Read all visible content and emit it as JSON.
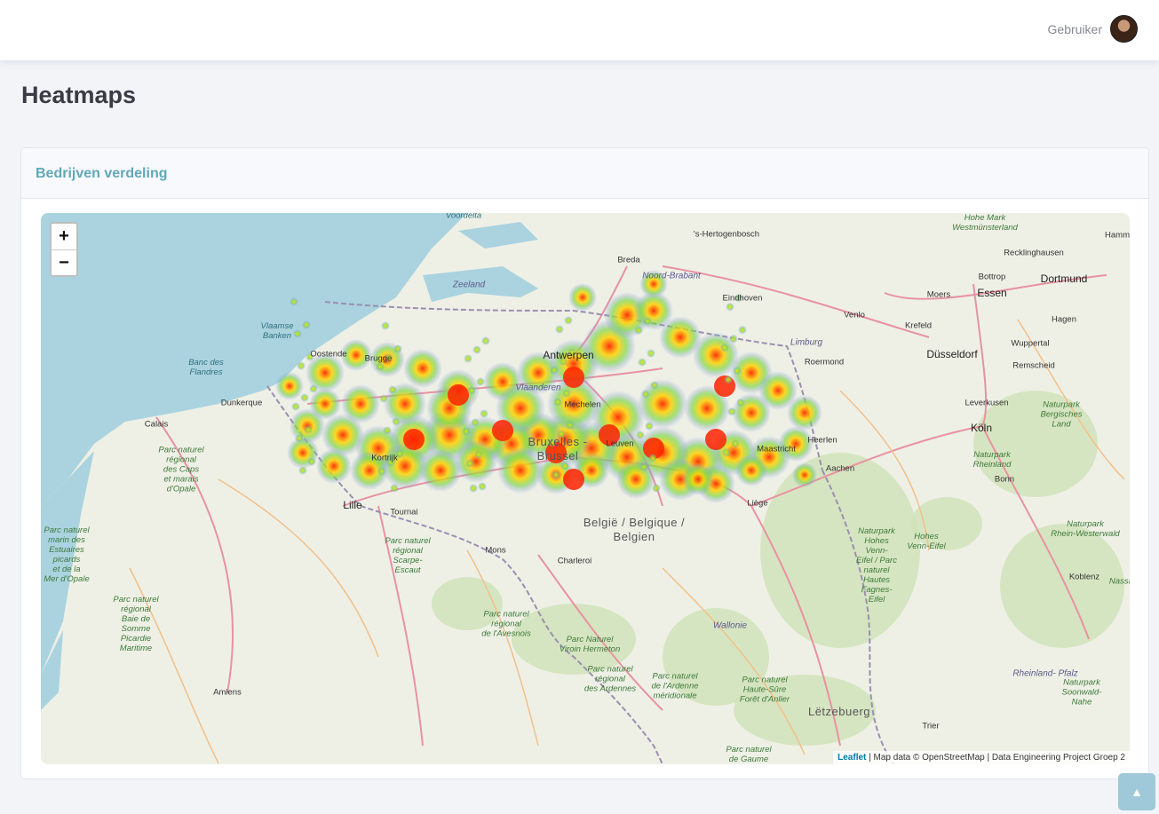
{
  "topbar": {
    "user_name": "Gebruiker"
  },
  "page": {
    "title": "Heatmaps"
  },
  "card": {
    "title": "Bedrijven verdeling"
  },
  "map": {
    "zoom_in": "+",
    "zoom_out": "−",
    "attribution_link": "Leaflet",
    "attribution_text": " | Map data © OpenStreetMap | Data Engineering Project Groep 2",
    "colors": {
      "sea": "#aad3df",
      "land": "#eef0e6",
      "heat_low": "#8888ff",
      "heat_mid": "#7fd84a",
      "heat_high": "#ff2a00"
    },
    "labels": [
      {
        "id": "voordelta",
        "text": "Voordelta",
        "kind": "sea"
      },
      {
        "id": "hertogenbosch",
        "text": "'s-Hertogenbosch",
        "kind": "city"
      },
      {
        "id": "hohe-mark",
        "text": "Hohe Mark\nWestmünsterland",
        "kind": "green"
      },
      {
        "id": "hamm",
        "text": "Hamm",
        "kind": "city"
      },
      {
        "id": "breda",
        "text": "Breda",
        "kind": "city"
      },
      {
        "id": "noord-brabant",
        "text": "Noord-Brabant",
        "kind": "region"
      },
      {
        "id": "recklinghausen",
        "text": "Recklinghausen",
        "kind": "city"
      },
      {
        "id": "zeeland",
        "text": "Zeeland",
        "kind": "region"
      },
      {
        "id": "bottrop",
        "text": "Bottrop",
        "kind": "city"
      },
      {
        "id": "essen",
        "text": "Essen",
        "kind": "big"
      },
      {
        "id": "dortmund",
        "text": "Dortmund",
        "kind": "big"
      },
      {
        "id": "eindhoven",
        "text": "Eindhoven",
        "kind": "city"
      },
      {
        "id": "moers",
        "text": "Moers",
        "kind": "city"
      },
      {
        "id": "venlo",
        "text": "Venlo",
        "kind": "city"
      },
      {
        "id": "krefeld",
        "text": "Krefeld",
        "kind": "city"
      },
      {
        "id": "hagen",
        "text": "Hagen",
        "kind": "city"
      },
      {
        "id": "vlaamse-banken",
        "text": "Vlaamse\nBanken",
        "kind": "sea"
      },
      {
        "id": "limburg",
        "text": "Limburg",
        "kind": "region"
      },
      {
        "id": "wuppertal",
        "text": "Wuppertal",
        "kind": "city"
      },
      {
        "id": "antwerpen",
        "text": "Antwerpen",
        "kind": "big"
      },
      {
        "id": "oostende",
        "text": "Oostende",
        "kind": "city"
      },
      {
        "id": "brugge",
        "text": "Brugge",
        "kind": "city"
      },
      {
        "id": "roermond",
        "text": "Roermond",
        "kind": "city"
      },
      {
        "id": "dusseldorf",
        "text": "Düsseldorf",
        "kind": "big"
      },
      {
        "id": "remscheid",
        "text": "Remscheid",
        "kind": "city"
      },
      {
        "id": "banc-des-flandres",
        "text": "Banc des\nFlandres",
        "kind": "sea"
      },
      {
        "id": "vlaanderen",
        "text": "Vlaanderen",
        "kind": "region"
      },
      {
        "id": "dunkerque",
        "text": "Dunkerque",
        "kind": "city"
      },
      {
        "id": "mechelen",
        "text": "Mechelen",
        "kind": "city"
      },
      {
        "id": "leverkusen",
        "text": "Leverkusen",
        "kind": "city"
      },
      {
        "id": "naturpark-bergisches",
        "text": "Naturpark\nBergisches\nLand",
        "kind": "green"
      },
      {
        "id": "calais",
        "text": "Calais",
        "kind": "city"
      },
      {
        "id": "koln",
        "text": "Köln",
        "kind": "big"
      },
      {
        "id": "heerlen",
        "text": "Heerlen",
        "kind": "city"
      },
      {
        "id": "brussel",
        "text": "Bruxelles -\nBrussel",
        "kind": "country"
      },
      {
        "id": "leuven",
        "text": "Leuven",
        "kind": "city"
      },
      {
        "id": "maastricht",
        "text": "Maastricht",
        "kind": "city"
      },
      {
        "id": "parc-caps",
        "text": "Parc naturel\nrégional\ndes Caps\net marais\nd'Opale",
        "kind": "green"
      },
      {
        "id": "kortrijk",
        "text": "Kortrijk",
        "kind": "city"
      },
      {
        "id": "naturpark-rheinland",
        "text": "Naturpark\nRheinland",
        "kind": "green"
      },
      {
        "id": "aachen",
        "text": "Aachen",
        "kind": "city"
      },
      {
        "id": "bonn",
        "text": "Bonn",
        "kind": "city"
      },
      {
        "id": "lille",
        "text": "Lille",
        "kind": "big"
      },
      {
        "id": "tournai",
        "text": "Tournai",
        "kind": "city"
      },
      {
        "id": "liege",
        "text": "Liège",
        "kind": "city"
      },
      {
        "id": "belgie",
        "text": "België / Belgique /\nBelgien",
        "kind": "country"
      },
      {
        "id": "parc-estuaires",
        "text": "Parc naturel\nmarin des\nEstuaires\npicards\net de la\nMer d'Opale",
        "kind": "green"
      },
      {
        "id": "parc-scarpe",
        "text": "Parc naturel\nrégional\nScarpe-\nEscaut",
        "kind": "green"
      },
      {
        "id": "naturpark-hohes",
        "text": "Naturpark\nHohes\nVenn-\nEifel / Parc\nnaturel\nHautes\nFagnes-\nEifel",
        "kind": "green"
      },
      {
        "id": "hohes-venn",
        "text": "Hohes\nVenn-Eifel",
        "kind": "green"
      },
      {
        "id": "naturpark-rhein",
        "text": "Naturpark\nRhein-Westerwald",
        "kind": "green"
      },
      {
        "id": "mons",
        "text": "Mons",
        "kind": "city"
      },
      {
        "id": "charleroi",
        "text": "Charleroi",
        "kind": "city"
      },
      {
        "id": "koblenz",
        "text": "Koblenz",
        "kind": "city"
      },
      {
        "id": "nassau",
        "text": "Nassau",
        "kind": "green"
      },
      {
        "id": "parc-baie",
        "text": "Parc naturel\nrégional\nBaie de\nSomme\nPicardie\nMaritime",
        "kind": "green"
      },
      {
        "id": "parc-avesnois",
        "text": "Parc naturel\nrégional\nde l'Avesnois",
        "kind": "green"
      },
      {
        "id": "wallonie",
        "text": "Wallonie",
        "kind": "region"
      },
      {
        "id": "parc-viroin",
        "text": "Parc Naturel\nViroin Hermeton",
        "kind": "green"
      },
      {
        "id": "parc-ardennes",
        "text": "Parc naturel\nrégional\ndes Ardennes",
        "kind": "green"
      },
      {
        "id": "parc-ardenne-meridionale",
        "text": "Parc naturel\nde l'Ardenne\nméridionale",
        "kind": "green"
      },
      {
        "id": "parc-haute-sure",
        "text": "Parc naturel\nHaute-Sûre\nForêt d'Anlier",
        "kind": "green"
      },
      {
        "id": "rheinland-pfalz",
        "text": "Rheinland-\nPfalz",
        "kind": "region"
      },
      {
        "id": "naturpark-soonwald",
        "text": "Naturpark\nSoonwald-\nNahe",
        "kind": "green"
      },
      {
        "id": "amiens",
        "text": "Amiens",
        "kind": "city"
      },
      {
        "id": "letzebuerg",
        "text": "Lëtzebuerg",
        "kind": "country"
      },
      {
        "id": "trier",
        "text": "Trier",
        "kind": "city"
      },
      {
        "id": "parc-gaume",
        "text": "Parc naturel\nde Gaume",
        "kind": "green"
      }
    ]
  },
  "scroll_top": {
    "icon": "▲"
  }
}
